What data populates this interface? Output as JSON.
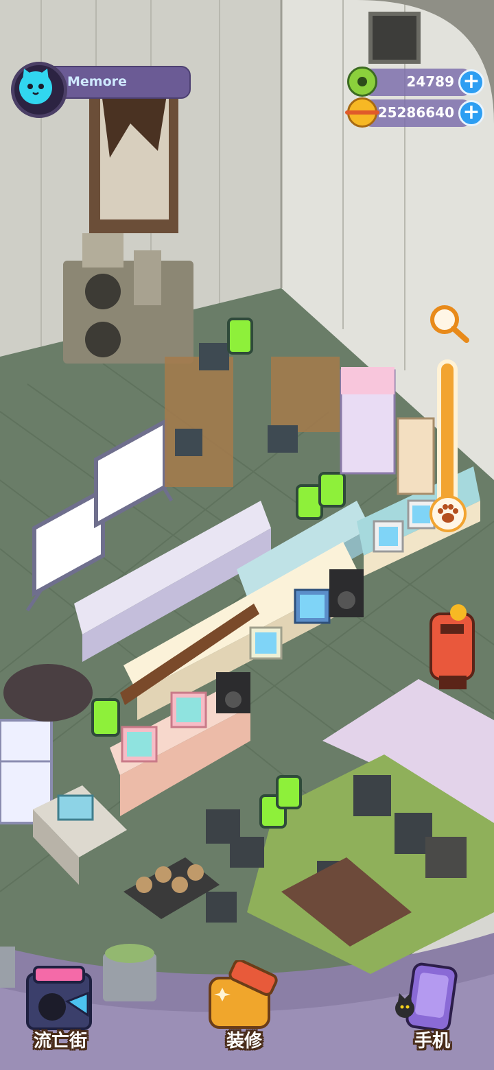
{
  "player": {
    "name": "Memore",
    "avatar_icon": "cat-face-icon",
    "avatar_color": "#31d6f0"
  },
  "currencies": [
    {
      "name": "donut-currency",
      "icon": "green-donut-icon",
      "value": "24789",
      "color": "#8bd03c"
    },
    {
      "name": "coin-currency",
      "icon": "yellow-planet-coin-icon",
      "value": "25286640",
      "color": "#f7b824"
    }
  ],
  "tools": {
    "search_icon": "magnifier-icon",
    "zoom_icon": "paw-icon",
    "zoom_level": 0.1
  },
  "bottom_nav": [
    {
      "id": "street",
      "label": "流亡街",
      "icon": "street-shop-icon"
    },
    {
      "id": "decorate",
      "label": "装修",
      "icon": "paint-roller-icon"
    },
    {
      "id": "phone",
      "label": "手机",
      "icon": "phone-icon"
    }
  ],
  "colors": {
    "accent_orange": "#f2a431",
    "hud_purple": "#6b5b95",
    "plus_blue": "#2d9ef2"
  }
}
